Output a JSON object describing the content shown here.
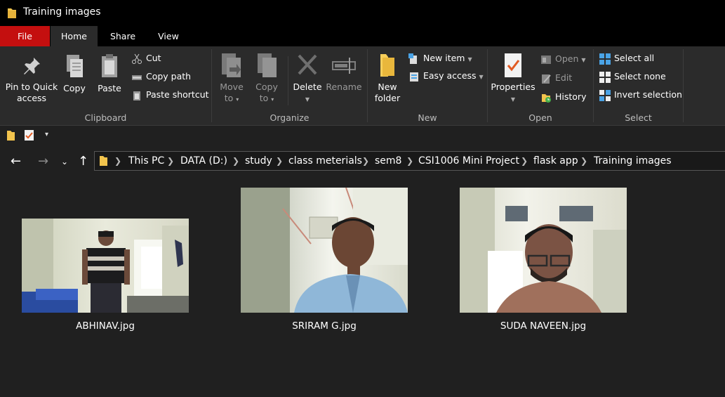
{
  "window": {
    "title": "Training images"
  },
  "tabs": {
    "file": "File",
    "home": "Home",
    "share": "Share",
    "view": "View"
  },
  "ribbon": {
    "clipboard": {
      "group_label": "Clipboard",
      "pin_line1": "Pin to Quick",
      "pin_line2": "access",
      "copy": "Copy",
      "paste": "Paste",
      "cut": "Cut",
      "copy_path": "Copy path",
      "paste_shortcut": "Paste shortcut"
    },
    "organize": {
      "group_label": "Organize",
      "move_line1": "Move",
      "move_line2": "to",
      "copy_line1": "Copy",
      "copy_line2": "to",
      "delete": "Delete",
      "rename": "Rename"
    },
    "new": {
      "group_label": "New",
      "folder_line1": "New",
      "folder_line2": "folder",
      "new_item": "New item",
      "easy_access": "Easy access"
    },
    "open": {
      "group_label": "Open",
      "properties": "Properties",
      "open": "Open",
      "edit": "Edit",
      "history": "History"
    },
    "select": {
      "group_label": "Select",
      "select_all": "Select all",
      "select_none": "Select none",
      "invert": "Invert selection"
    }
  },
  "breadcrumb": [
    "This PC",
    "DATA (D:)",
    "study",
    "class meterials",
    "sem8",
    "CSI1006 Mini Project",
    "flask app",
    "Training images"
  ],
  "files": [
    {
      "name": "ABHINAV.jpg"
    },
    {
      "name": "SRIRAM G.jpg"
    },
    {
      "name": "SUDA NAVEEN.jpg"
    }
  ]
}
